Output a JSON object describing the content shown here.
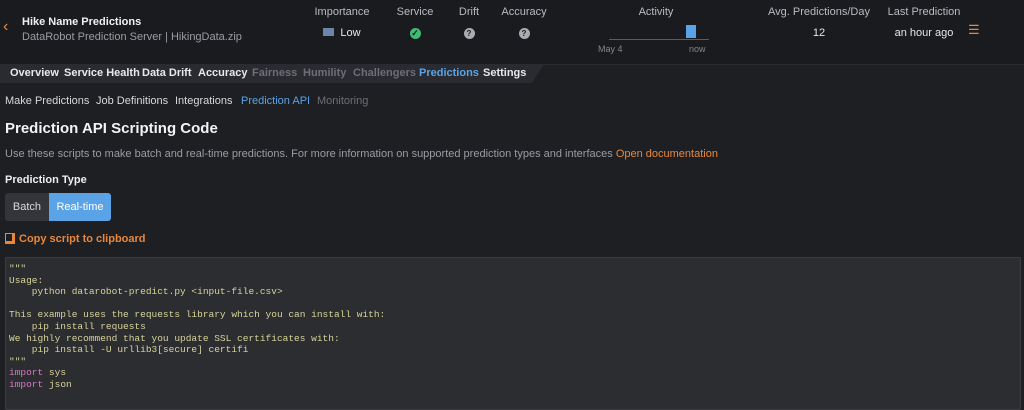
{
  "header": {
    "deployment_name": "Hike Name Predictions",
    "deployment_subtitle": "DataRobot Prediction Server | HikingData.zip",
    "importance": {
      "label": "Importance",
      "value": "Low"
    },
    "service": {
      "label": "Service",
      "status": "ok"
    },
    "drift": {
      "label": "Drift",
      "status": "unknown"
    },
    "accuracy": {
      "label": "Accuracy",
      "status": "unknown"
    },
    "activity": {
      "label": "Activity",
      "start": "May 4",
      "end": "now"
    },
    "avg_predictions": {
      "label": "Avg. Predictions/Day",
      "value": "12"
    },
    "last_prediction": {
      "label": "Last Prediction",
      "value": "an hour ago"
    },
    "icons": {
      "back": "chevron-left-icon",
      "menu": "hamburger-menu-icon",
      "service": "check-circle-icon",
      "drift": "question-circle-icon",
      "accuracy": "question-circle-icon",
      "importance": "importance-bars-icon"
    },
    "colors": {
      "accent": "#e8873c",
      "ok": "#3ebd73",
      "active": "#5aa3e6"
    }
  },
  "tabs": [
    {
      "label": "Overview",
      "state": "normal"
    },
    {
      "label": "Service Health",
      "state": "normal"
    },
    {
      "label": "Data Drift",
      "state": "normal"
    },
    {
      "label": "Accuracy",
      "state": "normal"
    },
    {
      "label": "Fairness",
      "state": "disabled"
    },
    {
      "label": "Humility",
      "state": "disabled"
    },
    {
      "label": "Challengers",
      "state": "disabled"
    },
    {
      "label": "Predictions",
      "state": "active"
    },
    {
      "label": "Settings",
      "state": "normal"
    }
  ],
  "subnav": [
    {
      "label": "Make Predictions",
      "state": "normal"
    },
    {
      "label": "Job Definitions",
      "state": "normal"
    },
    {
      "label": "Integrations",
      "state": "normal"
    },
    {
      "label": "Prediction API",
      "state": "active"
    },
    {
      "label": "Monitoring",
      "state": "disabled"
    }
  ],
  "page": {
    "title": "Prediction API Scripting Code",
    "description": "Use these scripts to make batch and real-time predictions. For more information on supported prediction types and interfaces",
    "doc_link": "Open documentation",
    "prediction_type_label": "Prediction Type",
    "prediction_type_options": [
      "Batch",
      "Real-time"
    ],
    "prediction_type_selected": "Real-time",
    "copy_label": "Copy script to clipboard",
    "copy_icon": "copy-icon"
  },
  "code": {
    "lines": [
      "\"\"\"",
      "Usage:",
      "    python datarobot-predict.py <input-file.csv>",
      "",
      "This example uses the requests library which you can install with:",
      "    pip install requests",
      "We highly recommend that you update SSL certificates with:",
      "    pip install -U urllib3[secure] certifi",
      "\"\"\"",
      "import sys",
      "import json"
    ]
  }
}
